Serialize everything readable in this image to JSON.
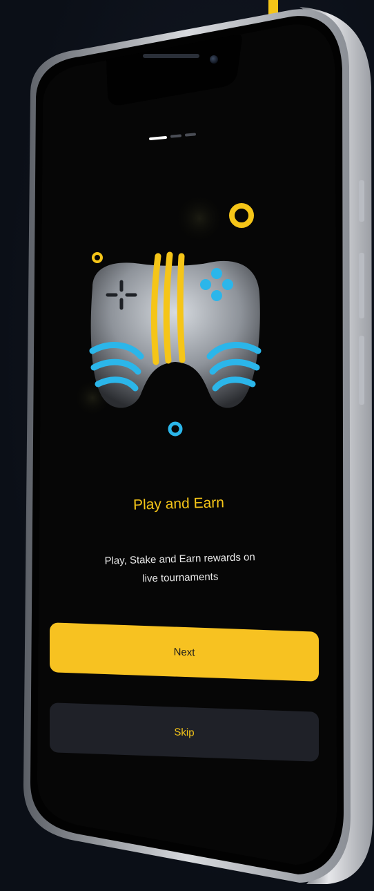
{
  "onboarding": {
    "title": "Play and Earn",
    "subtitle_line1": "Play, Stake and Earn rewards on",
    "subtitle_line2": "live tournaments",
    "page_indicator": {
      "current": 1,
      "total": 3
    },
    "illustration_icon": "gamepad-icon"
  },
  "actions": {
    "next_label": "Next",
    "skip_label": "Skip"
  },
  "colors": {
    "accent": "#f5c518",
    "button_primary": "#f7c221",
    "button_secondary": "#1f2128",
    "screen_background": "#060606",
    "page_background": "#0d111a",
    "gamepad_blue": "#2bb6ea"
  }
}
